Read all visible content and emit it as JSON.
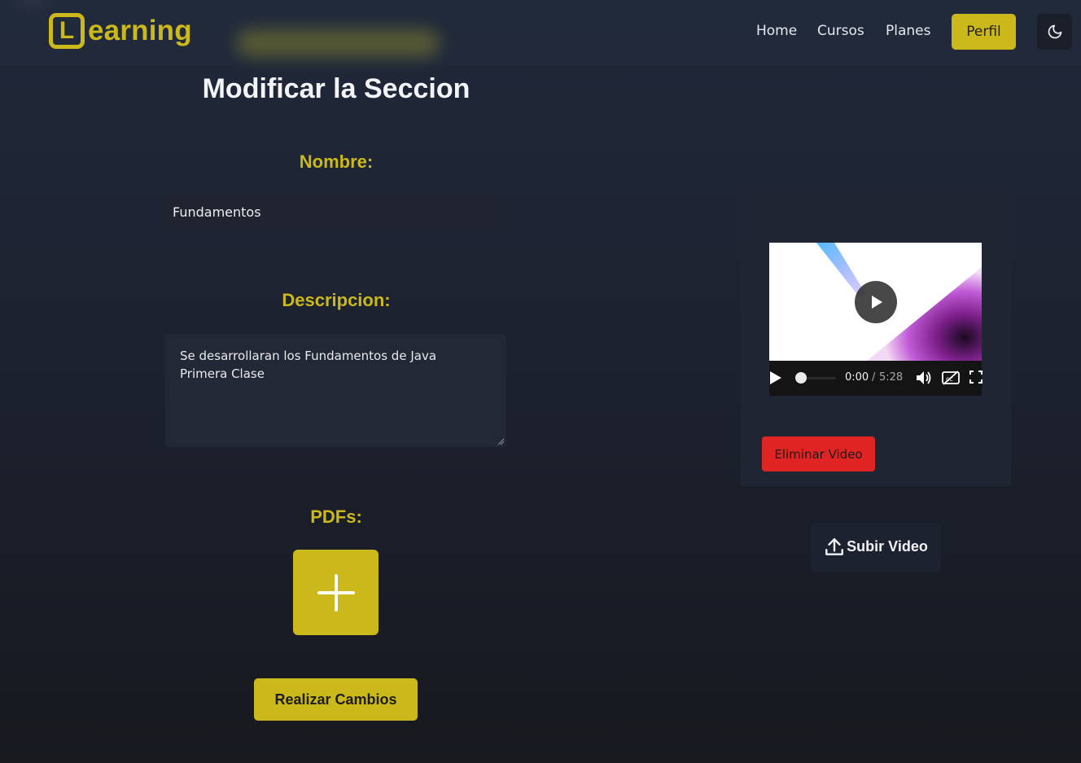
{
  "brand": {
    "logo_letter": "L",
    "logo_text": "earning",
    "accent_color": "#cbb81a"
  },
  "nav": {
    "home": "Home",
    "cursos": "Cursos",
    "planes": "Planes",
    "perfil": "Perfil",
    "theme_icon": "moon-icon"
  },
  "form": {
    "title": "Modificar la Seccion",
    "nombre_label": "Nombre:",
    "nombre_value": "Fundamentos",
    "descripcion_label": "Descripcion:",
    "descripcion_value": "Se desarrollaran los Fundamentos de Java\nPrimera Clase",
    "pdfs_label": "PDFs:",
    "add_pdf_icon": "plus-icon",
    "submit_label": "Realizar Cambios"
  },
  "video": {
    "current_time": "0:00",
    "separator": "/",
    "total_time": "5:28",
    "progress": 0,
    "delete_label": "Eliminar Video",
    "upload_label": "Subir Video",
    "upload_icon": "upload-icon",
    "delete_color": "#e02424"
  }
}
